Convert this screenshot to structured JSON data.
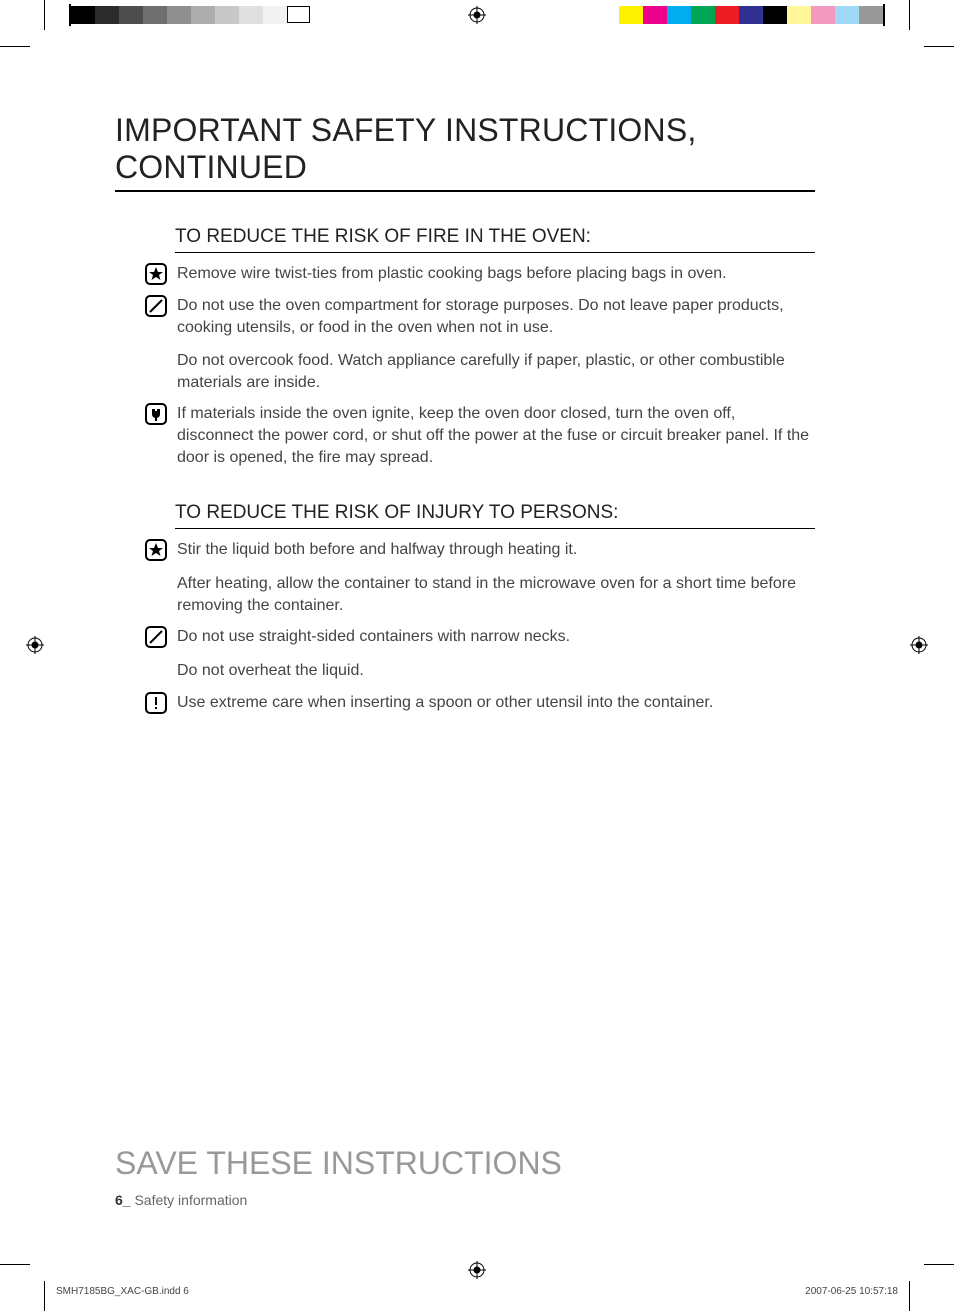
{
  "title": "IMPORTANT SAFETY INSTRUCTIONS, CONTINUED",
  "section1": {
    "heading": "TO REDUCE THE RISK OF FIRE IN THE OVEN:",
    "items": [
      "Remove wire twist-ties from plastic cooking bags before placing bags in oven.",
      "Do not use the oven compartment for storage purposes. Do not leave paper products, cooking utensils, or food in the oven when not in use.",
      "Do not overcook food. Watch appliance carefully if paper, plastic, or other combustible materials are inside.",
      "If materials inside the oven ignite, keep the oven door closed, turn the oven off, disconnect the power cord, or shut off the power at the fuse or circuit breaker panel. If the door is opened, the fire may spread."
    ]
  },
  "section2": {
    "heading": "TO REDUCE THE RISK OF INJURY TO PERSONS:",
    "items": [
      "Stir the liquid both before and halfway through heating it.",
      "After heating, allow the container to stand in the microwave oven for a short time before removing the container.",
      "Do not use straight-sided containers with narrow necks.",
      "Do not overheat the liquid.",
      "Use extreme care when inserting a spoon or other utensil into the container."
    ]
  },
  "save_heading": "SAVE THESE INSTRUCTIONS",
  "page_footer_num": "6_",
  "page_footer_label": " Safety information",
  "slug_left": "SMH7185BG_XAC-GB.indd   6",
  "slug_right": "2007-06-25     10:57:18"
}
